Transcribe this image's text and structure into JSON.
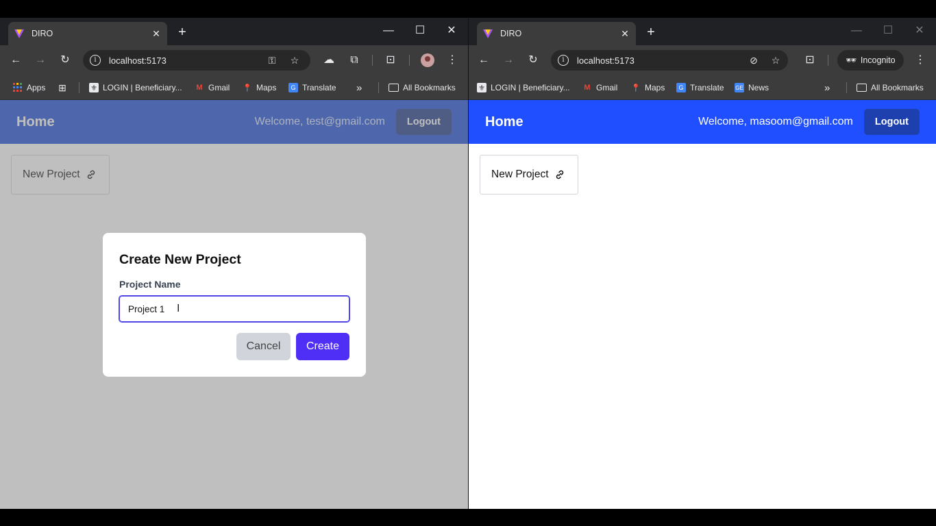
{
  "left_window": {
    "tab_title": "DIRO",
    "url": "localhost:5173",
    "bookmarks": [
      "Apps",
      "LOGIN | Beneficiary...",
      "Gmail",
      "Maps",
      "Translate",
      "All Bookmarks"
    ],
    "navbar": {
      "home": "Home",
      "welcome": "Welcome, test@gmail.com",
      "logout": "Logout"
    },
    "card_label": "New Project",
    "modal": {
      "title": "Create New Project",
      "field_label": "Project Name",
      "field_value": "Project 1",
      "cancel": "Cancel",
      "create": "Create"
    }
  },
  "right_window": {
    "tab_title": "DIRO",
    "url": "localhost:5173",
    "incognito": "Incognito",
    "bookmarks": [
      "LOGIN | Beneficiary...",
      "Gmail",
      "Maps",
      "Translate",
      "News",
      "All Bookmarks"
    ],
    "navbar": {
      "home": "Home",
      "welcome": "Welcome, masoom@gmail.com",
      "logout": "Logout"
    },
    "card_label": "New Project"
  },
  "colors": {
    "navbar_left": "#1d4ed8",
    "navbar_right": "#1f4fff",
    "create_button": "#4f2ef5",
    "cancel_button": "#d1d5db"
  }
}
